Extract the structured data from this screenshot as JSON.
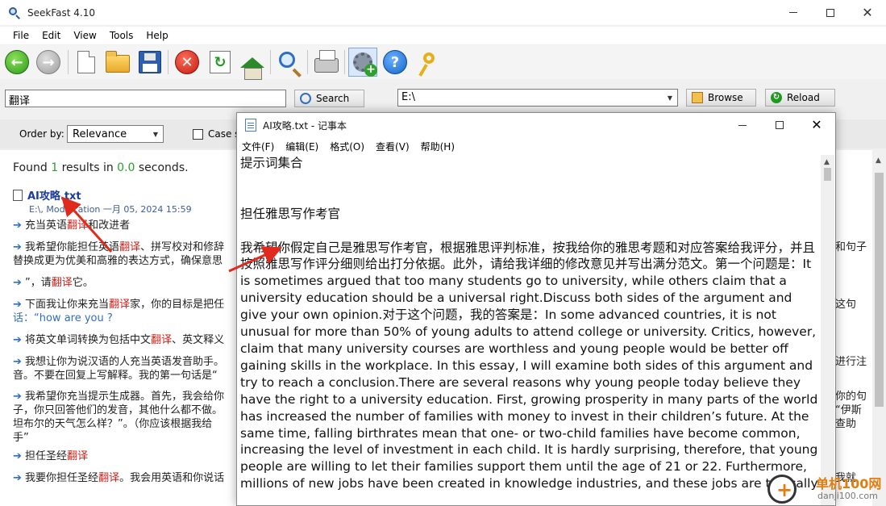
{
  "window": {
    "title": "SeekFast 4.10"
  },
  "menu": [
    "File",
    "Edit",
    "View",
    "Tools",
    "Help"
  ],
  "toolbar": {
    "icons": [
      "back-icon",
      "forward-icon",
      "new-document-icon",
      "open-folder-icon",
      "save-icon",
      "stop-icon",
      "refresh-icon",
      "home-icon",
      "find-icon",
      "print-icon",
      "settings-icon",
      "help-icon",
      "key-icon"
    ]
  },
  "search": {
    "query": "翻译",
    "search_label": "Search",
    "path": "E:\\",
    "browse_label": "Browse",
    "reload_label": "Reload"
  },
  "options": {
    "order_by_label": "Order by:",
    "order_by_value": "Relevance",
    "case_label": "Case s"
  },
  "results": {
    "found_prefix": "Found",
    "found_count": "1",
    "found_mid": "results in",
    "found_time": "0.0",
    "found_suffix": "seconds.",
    "file_name": "AI攻略.txt",
    "file_meta": "E:\\, Modification 一月 05, 2024 15:59",
    "snippets": [
      {
        "before": "充当英语",
        "hit": "翻译",
        "after": "和改进者",
        "line2": ""
      },
      {
        "before": "我希望你能担任英语",
        "hit": "翻译",
        "after": "、拼写校对和修辞",
        "tail": "和句子",
        "line2": "替换成更为优美和高雅的表达方式，确保意思"
      },
      {
        "before": "”，请",
        "hit": "翻译",
        "after": "它。",
        "line2": ""
      },
      {
        "before": "下面我让你来充当",
        "hit": "翻译",
        "after": "家，你的目标是把任",
        "tail": "这句",
        "line2": "话：“how are you ?"
      },
      {
        "before": "将英文单词转换为包括中文",
        "hit": "翻译",
        "after": "、英文释义",
        "line2": ""
      },
      {
        "before": "我想让你为说汉语的人充当英语发音助手。",
        "hit": "",
        "after": "",
        "tail": "进行注",
        "line2": "音。不要在回复上写解释。我的第一句话是“"
      },
      {
        "before": "我希望你充当提示生成器。首先，我会给你",
        "hit": "",
        "after": "",
        "tail": "你的句",
        "line2": "子，你只回答他们的发音，其他什么都不做。"
      },
      {
        "before": "担任圣经",
        "hit": "翻译",
        "after": "",
        "line2": ""
      },
      {
        "before": "我要你担任圣经",
        "hit": "翻译",
        "after": "。我会用英语和你说话",
        "tail": "我就",
        "line2": ""
      }
    ],
    "snippet_extra": {
      "line_a_tail": "“伊斯",
      "line_b": "坦布尔的天气怎么样？”。（你应该根据我给",
      "line_b_tail": "查助",
      "line_c": "手”"
    }
  },
  "notepad": {
    "title": "AI攻略.txt - 记事本",
    "menu": [
      "文件(F)",
      "编辑(E)",
      "格式(O)",
      "查看(V)",
      "帮助(H)"
    ],
    "content": "提示词集合\n\n\n担任雅思写作考官\n\n我希望你假定自己是雅思写作考官，根据雅思评判标准，按我给你的雅思考题和对应答案给我评分，并且按照雅思写作评分细则给出打分依据。此外，请给我详细的修改意见并写出满分范文。第一个问题是：It is sometimes argued that too many students go to university, while others claim that a university education should be a universal right.Discuss both sides of the argument and give your own opinion.对于这个问题，我的答案是：In some advanced countries, it is not unusual for more than 50% of young adults to attend college or university. Critics, however, claim that many university courses are worthless and young people would be better off gaining skills in the workplace. In this essay, I will examine both sides of this argument and try to reach a conclusion.There are several reasons why young people today believe they have the right to a university education. First, growing prosperity in many parts of the world has increased the number of families with money to invest in their children’s future. At the same time, falling birthrates mean that one- or two-child families have become common, increasing the level of investment in each child. It is hardly surprising, therefore, that young people are willing to let their families support them until the age of 21 or 22. Furthermore, millions of new jobs have been created in knowledge industries, and these jobs are typically"
  },
  "watermark": {
    "text": "单机100网",
    "url": "danji100.com"
  }
}
